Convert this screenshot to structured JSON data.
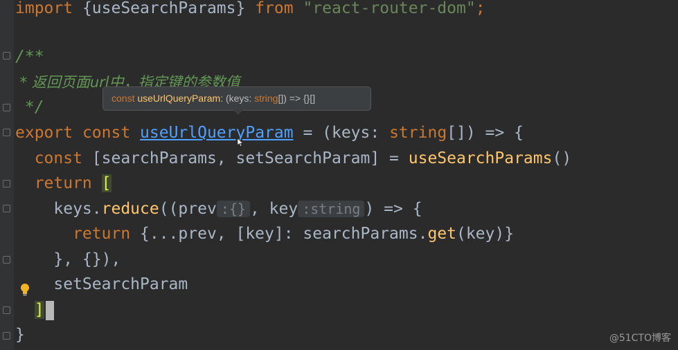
{
  "code": {
    "line1": {
      "kw1": "import",
      "mid": " {useSearchParams} ",
      "kw2": "from",
      "str": " \"react-router-dom\"",
      "semi": ";"
    },
    "line3": {
      "text": "/**"
    },
    "line4": {
      "text": " * 返回页面url中，指定键的参数值"
    },
    "line5": {
      "text": " */"
    },
    "line6": {
      "kw1": "export",
      "kw2": " const ",
      "name": "useUrlQueryParam",
      "rest": " = (keys: ",
      "type": "string",
      "end": "[]) => {"
    },
    "line7": {
      "kw": "  const",
      "mid": " [searchParams, setSearchParam] = ",
      "fn": "useSearchParams",
      "end": "()"
    },
    "line8": {
      "kw": "  return",
      "sp": " ",
      "br": "["
    },
    "line9": {
      "pre": "    keys.",
      "fn": "reduce",
      "mid": "((prev",
      "hint1": ":{}",
      "mid2": ", key",
      "hint2": ":string",
      "end": ") => {"
    },
    "line10": {
      "kw": "      return",
      "mid": " {...prev, [key]: searchParams.",
      "fn": "get",
      "end": "(key)}"
    },
    "line11": {
      "text": "    }, {}),"
    },
    "line12": {
      "text": "    setSearchParam"
    },
    "line13": {
      "pre": "  ",
      "br": "]"
    },
    "line14": {
      "text": "}"
    }
  },
  "tooltip": {
    "k1": "const ",
    "name": "useUrlQueryParam",
    "t1": ": (keys: ",
    "type": "string",
    "t2": "[]) => {}[]"
  },
  "watermark": "@51CTO博客",
  "icons": {
    "bulb": "lightbulb-icon",
    "fold": "fold-marker-icon",
    "cursor": "mouse-pointer-icon"
  }
}
